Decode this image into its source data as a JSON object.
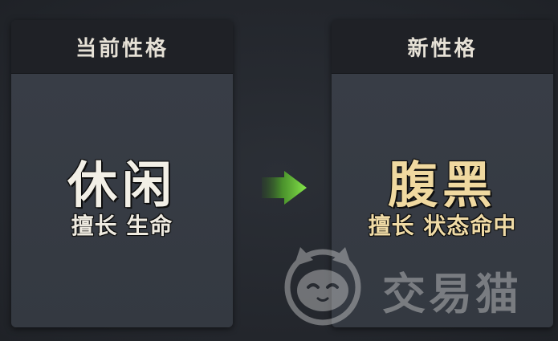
{
  "current_trait": {
    "header": "当前性格",
    "name": "休闲",
    "specialty": "擅长 生命"
  },
  "new_trait": {
    "header": "新性格",
    "name": "腹黑",
    "specialty": "擅长 状态命中"
  },
  "arrow_icon": "right-arrow-icon",
  "colors": {
    "current_name": "#f2efe6",
    "new_name": "#f0d9a0",
    "arrow": "#6fd13a"
  },
  "watermark": {
    "text": "交易猫"
  }
}
